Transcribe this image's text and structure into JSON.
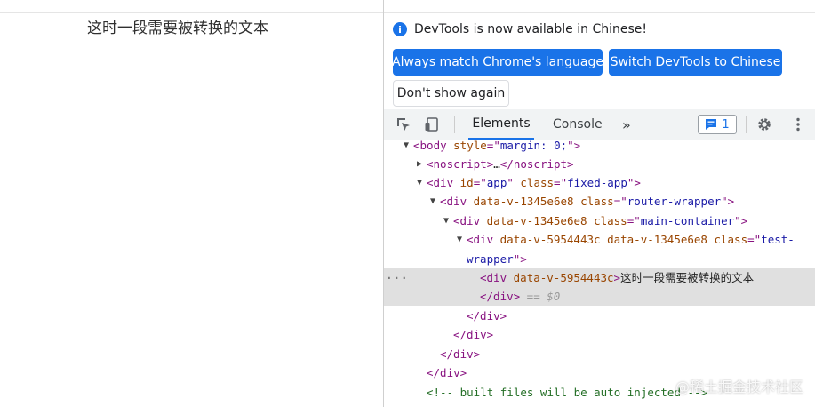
{
  "page": {
    "text": "这时一段需要被转换的文本"
  },
  "devtools": {
    "info_text": "DevTools is now available in Chinese!",
    "btn_match": "Always match Chrome's language",
    "btn_switch": "Switch DevTools to Chinese",
    "btn_dont_show": "Don't show again",
    "tabs": [
      "Elements",
      "Console",
      "»"
    ],
    "issues_count": "1",
    "accent": "#1a73e8"
  },
  "dom": {
    "l1": [
      "<body ",
      "style",
      "=\"",
      "margin: 0;",
      "\">"
    ],
    "l2": [
      "<noscript>",
      "…",
      "</noscript>"
    ],
    "l3": [
      "<div ",
      "id",
      "=\"",
      "app",
      "\" ",
      "class",
      "=\"",
      "fixed-app",
      "\">"
    ],
    "l4": [
      "<div ",
      "data-v-1345e6e8",
      " ",
      "class",
      "=\"",
      "router-wrapper",
      "\">"
    ],
    "l5": [
      "<div ",
      "data-v-1345e6e8",
      " ",
      "class",
      "=\"",
      "main-container",
      "\">"
    ],
    "l6": [
      "<div ",
      "data-v-5954443c",
      " ",
      "data-v-1345e6e8",
      " ",
      "class",
      "=\"",
      "test-",
      ""
    ],
    "l7": [
      "wrapper",
      "\">"
    ],
    "l8": [
      "<div ",
      "data-v-5954443c",
      ">",
      "这时一段需要被转换的文本"
    ],
    "l9": [
      "</div>",
      " == $0"
    ],
    "l10": "</div>",
    "l11": "</div>",
    "l12": "</div>",
    "l13": "</div>",
    "l14": "<!-- built files will be auto injected -->",
    "dots": "···"
  },
  "watermark": "@稀土掘金技术社区"
}
